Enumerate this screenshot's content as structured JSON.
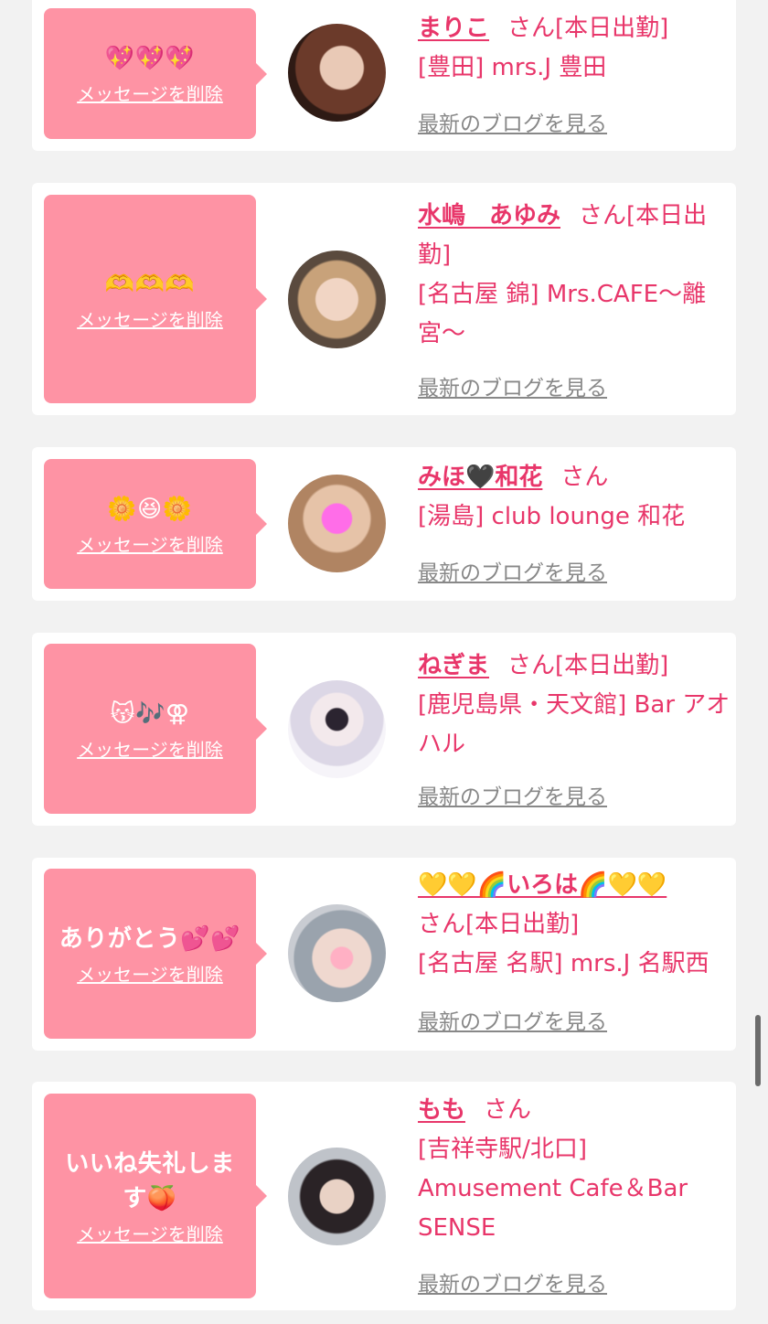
{
  "delete_label": "メッセージを削除",
  "blog_label": "最新のブログを見る",
  "colors": {
    "accent": "#e8366a",
    "bubble": "#fe93a4",
    "muted": "#888888"
  },
  "cards": [
    {
      "message": "💖💖💖",
      "name": "まりこ",
      "honorific": "さん",
      "status": "[本日出勤]",
      "shop": "[豊田] mrs.J 豊田"
    },
    {
      "message": "🫶🫶🫶",
      "name": "水嶋　あゆみ",
      "honorific": "さん",
      "status": "[本日出勤]",
      "shop": "[名古屋 錦] Mrs.CAFE〜離宮〜"
    },
    {
      "message": "🌼😆🌼",
      "name": "みほ🖤和花",
      "honorific": "さん",
      "status": "",
      "shop": "[湯島] club lounge 和花"
    },
    {
      "message": "😽🎶⚢",
      "name": "ねぎま",
      "honorific": "さん",
      "status": "[本日出勤]",
      "shop": "[鹿児島県・天文館] Bar アオハル"
    },
    {
      "message": "ありがとう💕💕",
      "name": "💛💛🌈いろは🌈💛💛",
      "honorific": "さん",
      "status": "[本日出勤]",
      "shop": "[名古屋 名駅] mrs.J 名駅西"
    },
    {
      "message": "いいね失礼します🍑",
      "name": "もも",
      "honorific": "さん",
      "status": "",
      "shop": "[吉祥寺駅/北口] Amusement Cafe＆Bar SENSE"
    }
  ]
}
